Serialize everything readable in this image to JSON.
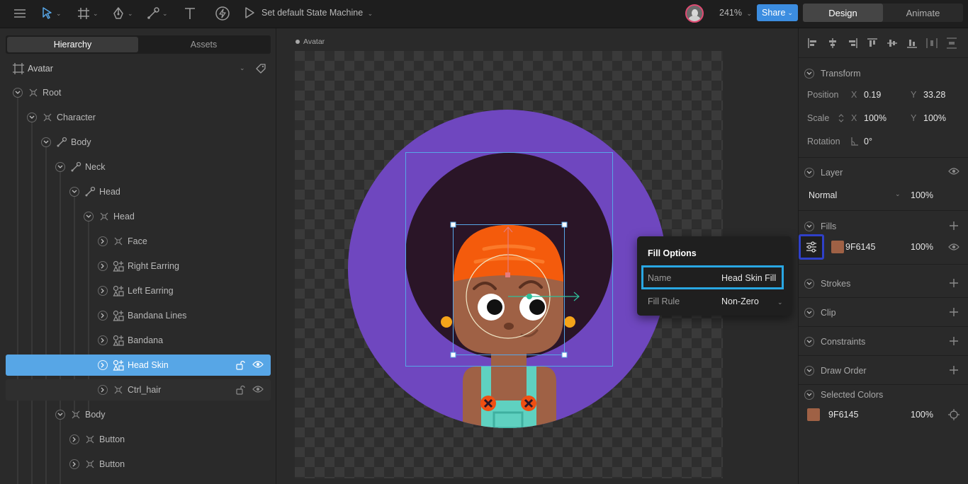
{
  "toolbar": {
    "state_machine_label": "Set default State Machine",
    "zoom": "241%",
    "share_label": "Share",
    "mode_tabs": [
      "Design",
      "Animate"
    ],
    "active_mode": "Design"
  },
  "left_panel": {
    "tabs": [
      "Hierarchy",
      "Assets"
    ],
    "active_tab": "Hierarchy",
    "artboard_name": "Avatar",
    "tree": [
      {
        "label": "Root",
        "icon": "group-icon",
        "depth": 0
      },
      {
        "label": "Character",
        "icon": "group-icon",
        "depth": 1
      },
      {
        "label": "Body",
        "icon": "bone-icon",
        "depth": 2
      },
      {
        "label": "Neck",
        "icon": "bone-icon",
        "depth": 3
      },
      {
        "label": "Head",
        "icon": "bone-icon",
        "depth": 4
      },
      {
        "label": "Head",
        "icon": "group-icon",
        "depth": 5
      },
      {
        "label": "Face",
        "icon": "group-icon",
        "depth": 6
      },
      {
        "label": "Right Earring",
        "icon": "shapes-icon",
        "depth": 6
      },
      {
        "label": "Left Earring",
        "icon": "shapes-icon",
        "depth": 6
      },
      {
        "label": "Bandana Lines",
        "icon": "shapes-icon",
        "depth": 6
      },
      {
        "label": "Bandana",
        "icon": "shapes-icon",
        "depth": 6
      },
      {
        "label": "Head Skin",
        "icon": "shapes-icon",
        "depth": 6,
        "selected": true
      },
      {
        "label": "Ctrl_hair",
        "icon": "group-icon",
        "depth": 6,
        "hovered": true
      },
      {
        "label": "Body",
        "icon": "group-icon",
        "depth": 3
      },
      {
        "label": "Button",
        "icon": "group-icon",
        "depth": 4
      },
      {
        "label": "Button",
        "icon": "group-icon",
        "depth": 4
      }
    ]
  },
  "canvas": {
    "artboard_label": "Avatar"
  },
  "fill_options": {
    "title": "Fill Options",
    "name_label": "Name",
    "name_value": "Head Skin Fill",
    "fill_rule_label": "Fill Rule",
    "fill_rule_value": "Non-Zero"
  },
  "right_panel": {
    "transform": {
      "title": "Transform",
      "position_label": "Position",
      "x_axis": "X",
      "y_axis": "Y",
      "position_x": "0.19",
      "position_y": "33.28",
      "scale_label": "Scale",
      "scale_x": "100%",
      "scale_y": "100%",
      "rotation_label": "Rotation",
      "rotation": "0°"
    },
    "layer": {
      "title": "Layer",
      "blend_mode": "Normal",
      "opacity": "100%"
    },
    "fills": {
      "title": "Fills",
      "color_hex": "9F6145",
      "color": "#9f6145",
      "opacity": "100%"
    },
    "sections": [
      "Strokes",
      "Clip",
      "Constraints",
      "Draw Order"
    ],
    "selected_colors": {
      "title": "Selected Colors",
      "color_hex": "9F6145",
      "color": "#9f6145",
      "opacity": "100%"
    }
  },
  "colors": {
    "accent": "#3c8de0",
    "selection": "#57a6e6",
    "highlight_box": "#29a7e3",
    "fill_button_outline": "#2f40c8",
    "avatar_background": "#6f47bf",
    "hair": "#2a1527",
    "skin": "#9f6145",
    "bandana": "#f45b0c",
    "overalls": "#5fd1c0"
  }
}
